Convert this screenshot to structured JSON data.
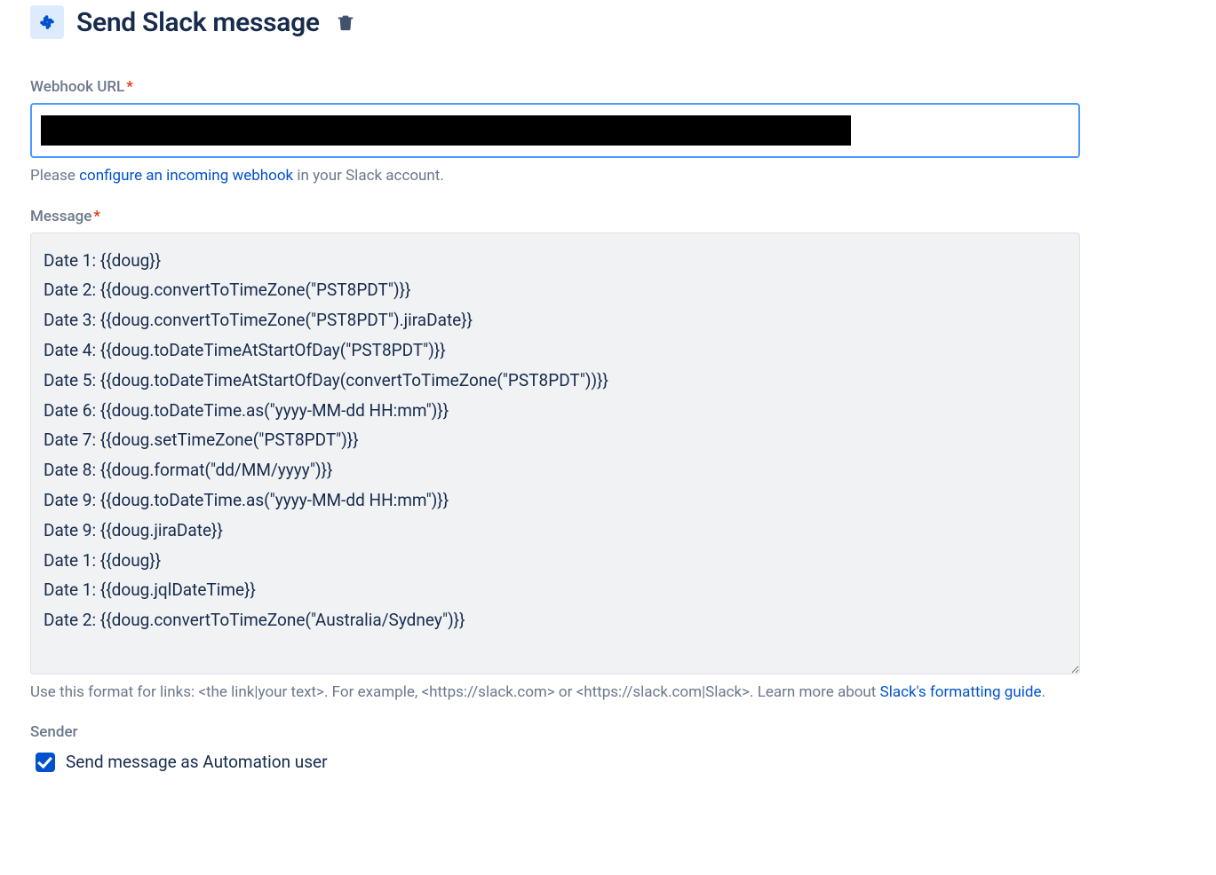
{
  "header": {
    "title": "Send Slack message"
  },
  "webhook": {
    "label": "Webhook URL",
    "help_prefix": "Please ",
    "help_link_text": "configure an incoming webhook",
    "help_suffix": " in your Slack account."
  },
  "message": {
    "label": "Message",
    "value": "Date 1: {{doug}}\nDate 2: {{doug.convertToTimeZone(\"PST8PDT\")}}\nDate 3: {{doug.convertToTimeZone(\"PST8PDT\").jiraDate}}\nDate 4: {{doug.toDateTimeAtStartOfDay(\"PST8PDT\")}}\nDate 5: {{doug.toDateTimeAtStartOfDay(convertToTimeZone(\"PST8PDT\"))}}\nDate 6: {{doug.toDateTime.as(\"yyyy-MM-dd HH:mm\")}}\nDate 7: {{doug.setTimeZone(\"PST8PDT\")}}\nDate 8: {{doug.format(\"dd/MM/yyyy\")}}\nDate 9: {{doug.toDateTime.as(\"yyyy-MM-dd HH:mm\")}}\nDate 9: {{doug.jiraDate}}\nDate 1: {{doug}}\nDate 1: {{doug.jqlDateTime}}\nDate 2: {{doug.convertToTimeZone(\"Australia/Sydney\")}}",
    "help_prefix": "Use this format for links: <the link|your text>. For example, <https://slack.com> or <https://slack.com|Slack>. Learn more about ",
    "help_link_text": "Slack's formatting guide",
    "help_suffix": "."
  },
  "sender": {
    "label": "Sender",
    "checkbox_label": "Send message as Automation user",
    "checked": true
  }
}
